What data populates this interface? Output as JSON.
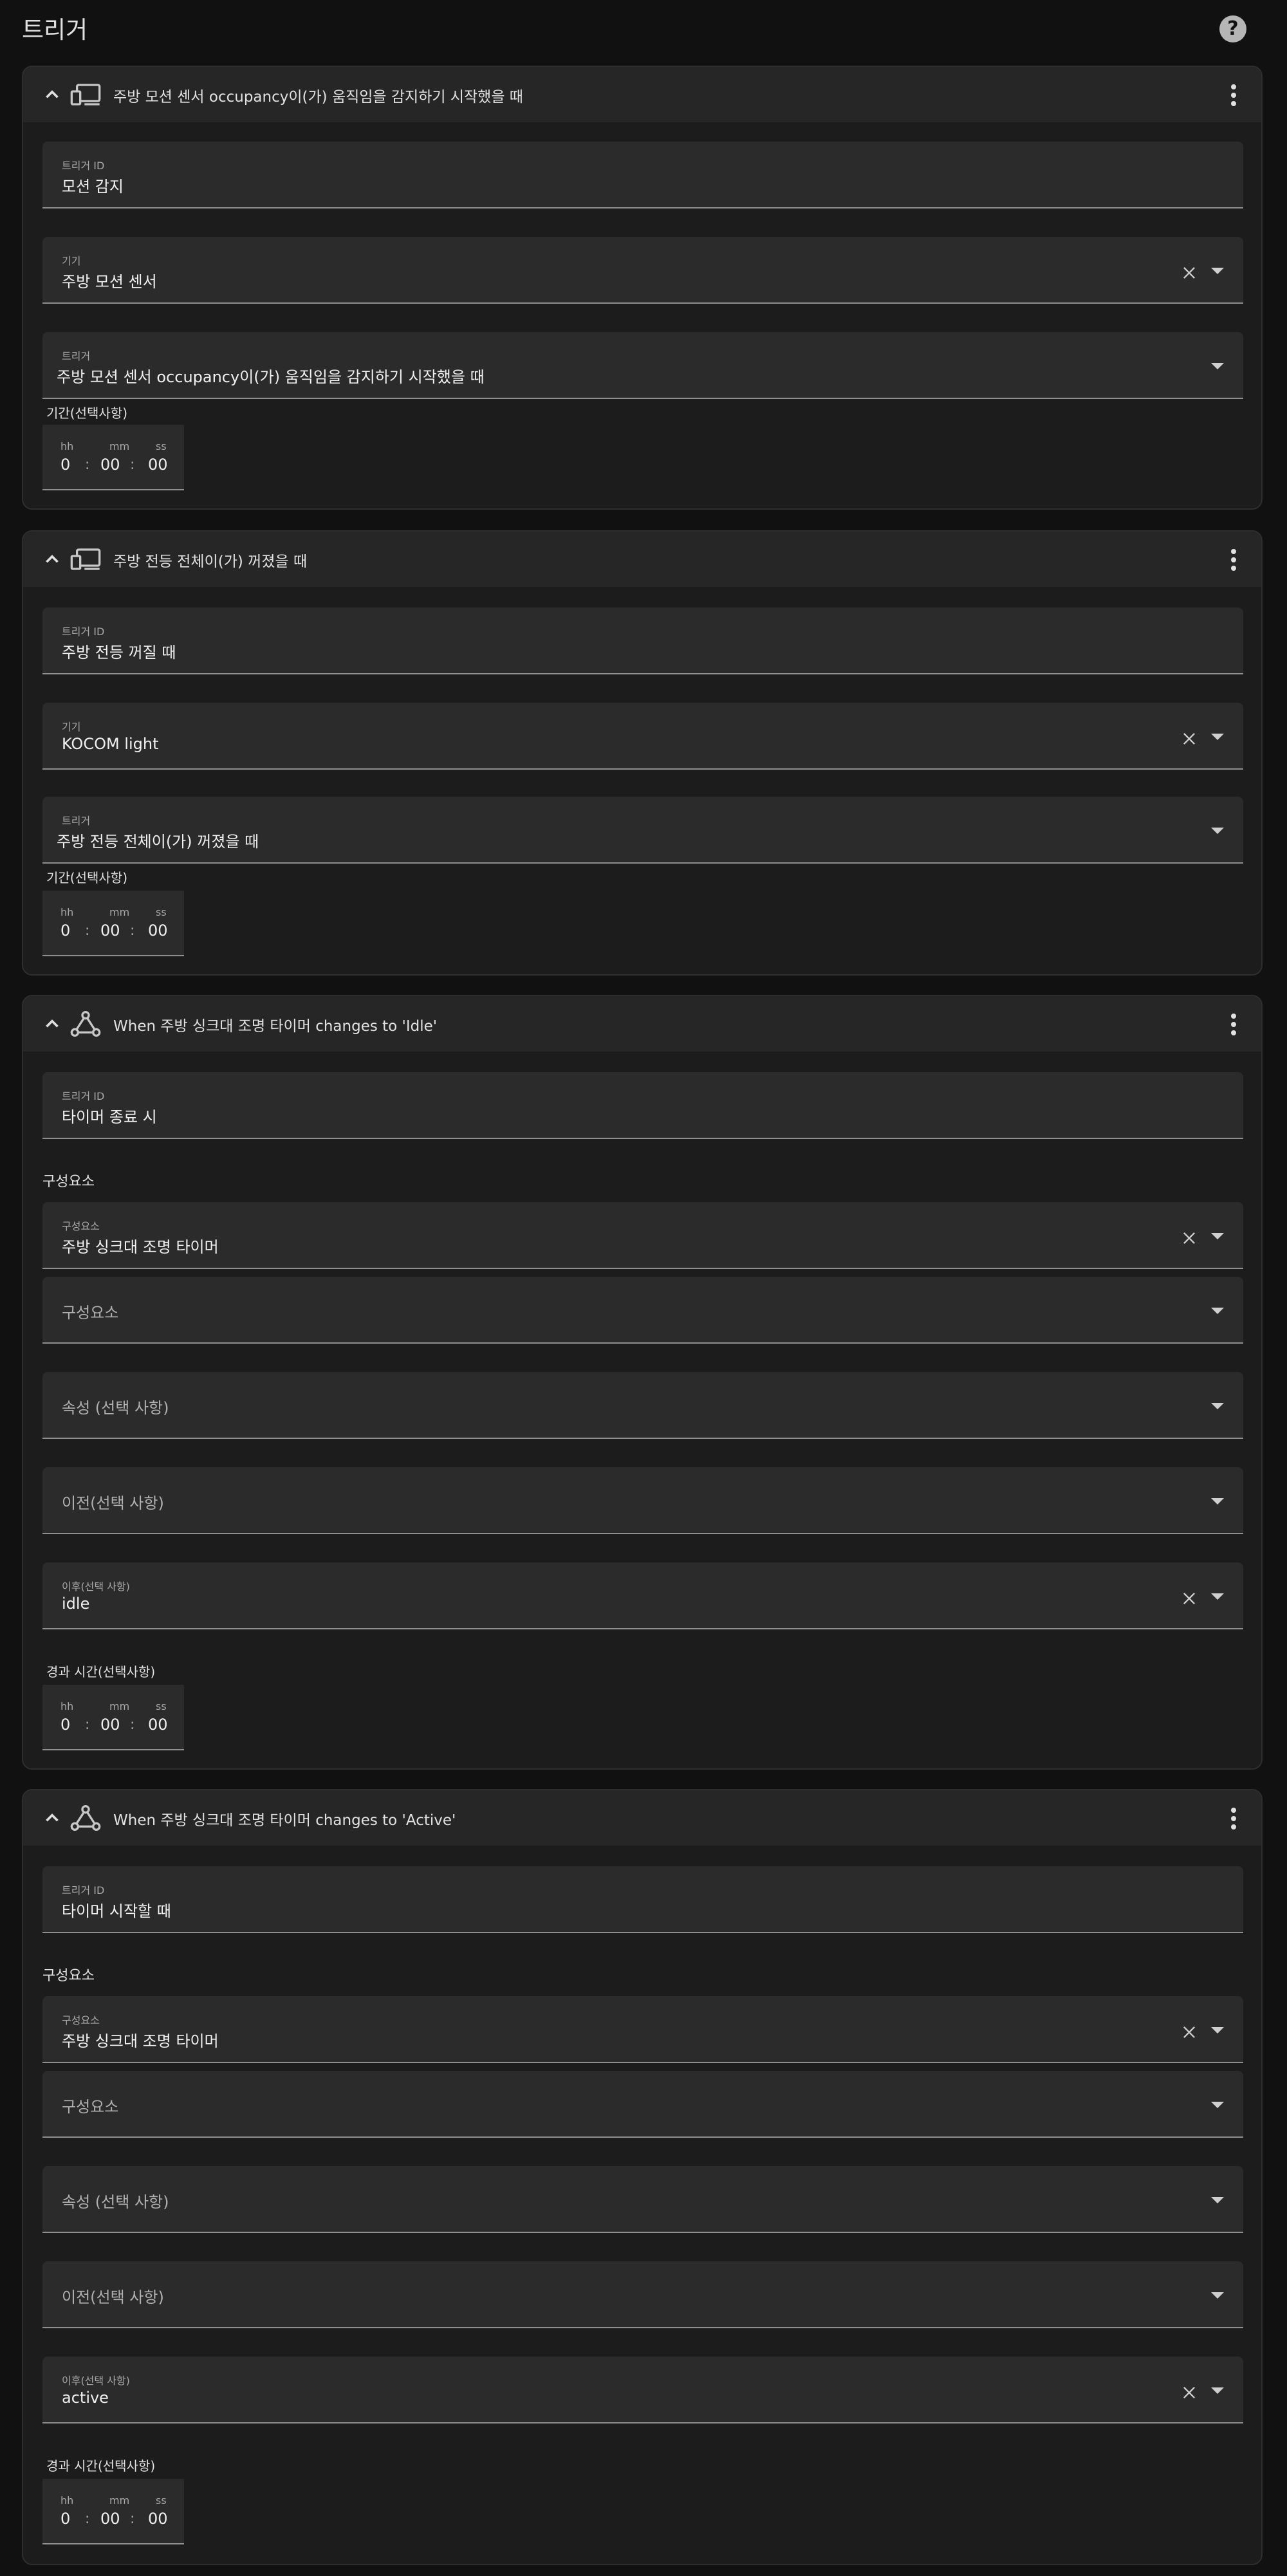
{
  "page": {
    "title": "트리거",
    "help_icon": "help-circle-icon"
  },
  "triggers": [
    {
      "icon": "device-icon",
      "title": "주방 모션 센서 occupancy이(가) 움직임을 감지하기 시작했을 때",
      "id_label": "트리거 ID",
      "id_value": "모션 감지",
      "device_label": "기기",
      "device_value": "주방 모션 센서",
      "trigger_label": "트리거",
      "trigger_value": "주방 모션 센서 occupancy이(가) 움직임을 감지하기 시작했을 때",
      "duration_label": "기간(선택사항)",
      "duration": {
        "hh_label": "hh",
        "mm_label": "mm",
        "ss_label": "ss",
        "hh": "0",
        "mm": "00",
        "ss": "00",
        "sep": ":"
      }
    },
    {
      "icon": "device-icon",
      "title": "주방 전등 전체이(가) 꺼졌을 때",
      "id_label": "트리거 ID",
      "id_value": "주방 전등 꺼질 때",
      "device_label": "기기",
      "device_value": "KOCOM light",
      "trigger_label": "트리거",
      "trigger_value": "주방 전등 전체이(가) 꺼졌을 때",
      "duration_label": "기간(선택사항)",
      "duration": {
        "hh_label": "hh",
        "mm_label": "mm",
        "ss_label": "ss",
        "hh": "0",
        "mm": "00",
        "ss": "00",
        "sep": ":"
      }
    },
    {
      "icon": "state-icon",
      "title": "When 주방 싱크대 조명 타이머 changes to 'Idle'",
      "id_label": "트리거 ID",
      "id_value": "타이머 종료 시",
      "section_label": "구성요소",
      "entity_label": "구성요소",
      "entity_value": "주방 싱크대 조명 타이머",
      "entity2_placeholder": "구성요소",
      "attribute_placeholder": "속성 (선택 사항)",
      "from_placeholder": "이전(선택 사항)",
      "to_label": "이후(선택 사항)",
      "to_value": "idle",
      "duration_label": "경과 시간(선택사항)",
      "duration": {
        "hh_label": "hh",
        "mm_label": "mm",
        "ss_label": "ss",
        "hh": "0",
        "mm": "00",
        "ss": "00",
        "sep": ":"
      }
    },
    {
      "icon": "state-icon",
      "title": "When 주방 싱크대 조명 타이머 changes to 'Active'",
      "id_label": "트리거 ID",
      "id_value": "타이머 시작할 때",
      "section_label": "구성요소",
      "entity_label": "구성요소",
      "entity_value": "주방 싱크대 조명 타이머",
      "entity2_placeholder": "구성요소",
      "attribute_placeholder": "속성 (선택 사항)",
      "from_placeholder": "이전(선택 사항)",
      "to_label": "이후(선택 사항)",
      "to_value": "active",
      "duration_label": "경과 시간(선택사항)",
      "duration": {
        "hh_label": "hh",
        "mm_label": "mm",
        "ss_label": "ss",
        "hh": "0",
        "mm": "00",
        "ss": "00",
        "sep": ":"
      }
    }
  ]
}
